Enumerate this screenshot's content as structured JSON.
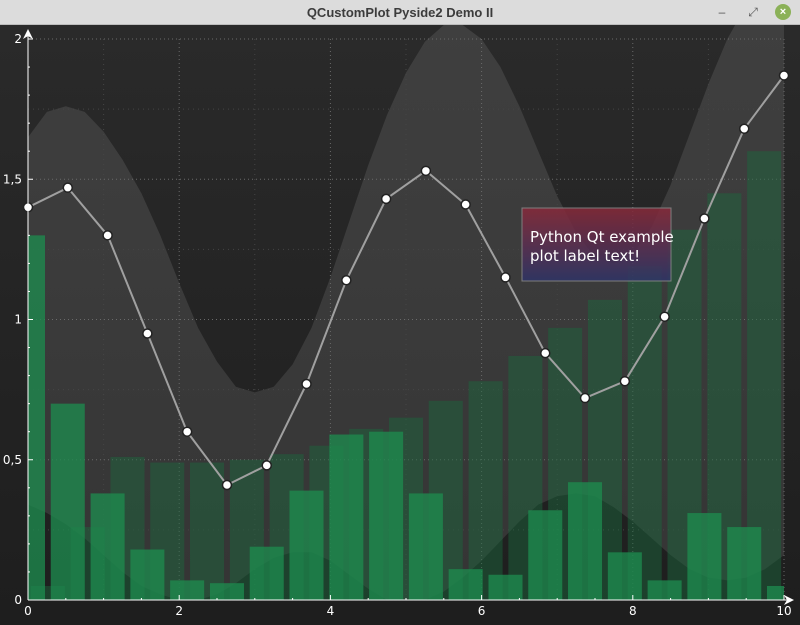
{
  "window": {
    "title": "QCustomPlot Pyside2 Demo II",
    "buttons": {
      "minimize": "–",
      "maximize": "⤢",
      "close": "×"
    }
  },
  "label_box": {
    "lines": [
      "Python Qt example",
      "plot label text!"
    ]
  },
  "colors": {
    "background_top": "#2a2a2a",
    "background_bottom": "#1e1e1e",
    "bar_front": "#1d8a4e",
    "bar_back": "#1a6a3f",
    "line": "#a0a0a0",
    "marker_fill": "#ffffff",
    "band": "#ffffff",
    "label_box_top": "#8a2a3a",
    "label_box_bottom": "#2e3468"
  },
  "chart_data": {
    "type": "line",
    "title": "",
    "xlabel": "",
    "ylabel": "",
    "xlim": [
      0,
      10
    ],
    "ylim": [
      0,
      2
    ],
    "x_ticks": [
      0,
      2,
      4,
      6,
      8,
      10
    ],
    "x_tick_labels": [
      "0",
      "2",
      "4",
      "6",
      "8",
      "10"
    ],
    "y_ticks": [
      0,
      0.5,
      1,
      1.5,
      2
    ],
    "y_tick_labels": [
      "0",
      "0,5",
      "1",
      "1,5",
      "2"
    ],
    "grid": true,
    "line_series": {
      "x": [
        0,
        0.526,
        1.053,
        1.579,
        2.105,
        2.632,
        3.158,
        3.684,
        4.211,
        4.737,
        5.263,
        5.789,
        6.316,
        6.842,
        7.368,
        7.895,
        8.421,
        8.947,
        9.474,
        10
      ],
      "y": [
        1.4,
        1.47,
        1.3,
        0.95,
        0.6,
        0.41,
        0.48,
        0.77,
        1.14,
        1.43,
        1.53,
        1.41,
        1.15,
        0.88,
        0.72,
        0.78,
        1.01,
        1.36,
        1.68,
        1.87
      ]
    },
    "bars_front": {
      "x": [
        0,
        0.526,
        1.053,
        1.579,
        2.105,
        2.632,
        3.158,
        3.684,
        4.211,
        4.737,
        5.263,
        5.789,
        6.316,
        6.842,
        7.368,
        7.895,
        8.421,
        8.947,
        9.474,
        10
      ],
      "values": [
        1.3,
        0.7,
        0.38,
        0.18,
        0.07,
        0.06,
        0.19,
        0.39,
        0.59,
        0.6,
        0.38,
        0.11,
        0.09,
        0.32,
        0.42,
        0.17,
        0.07,
        0.31,
        0.26,
        0.05
      ]
    },
    "bars_back": {
      "x": [
        0.263,
        0.789,
        1.316,
        1.842,
        2.368,
        2.895,
        3.421,
        3.947,
        4.474,
        5.0,
        5.526,
        6.053,
        6.579,
        7.105,
        7.632,
        8.158,
        8.684,
        9.211,
        9.737
      ],
      "values": [
        0.05,
        0.26,
        0.51,
        0.49,
        0.49,
        0.5,
        0.52,
        0.55,
        0.61,
        0.65,
        0.71,
        0.78,
        0.87,
        0.97,
        1.07,
        1.19,
        1.32,
        1.45,
        1.6
      ]
    },
    "band": {
      "x": [
        0,
        0.25,
        0.5,
        0.75,
        1,
        1.25,
        1.5,
        1.75,
        2,
        2.25,
        2.5,
        2.75,
        3,
        3.25,
        3.5,
        3.75,
        4,
        4.25,
        4.5,
        4.75,
        5,
        5.25,
        5.5,
        5.75,
        6,
        6.25,
        6.5,
        6.75,
        7,
        7.25,
        7.5,
        7.75,
        8,
        8.25,
        8.5,
        8.75,
        9,
        9.25,
        9.5,
        9.75,
        10
      ],
      "upper": [
        1.65,
        1.74,
        1.76,
        1.74,
        1.67,
        1.57,
        1.45,
        1.3,
        1.13,
        0.97,
        0.85,
        0.76,
        0.74,
        0.76,
        0.84,
        0.97,
        1.15,
        1.35,
        1.55,
        1.73,
        1.88,
        1.99,
        2.05,
        2.05,
        2.0,
        1.9,
        1.76,
        1.6,
        1.44,
        1.31,
        1.22,
        1.2,
        1.23,
        1.33,
        1.48,
        1.66,
        1.84,
        2.0,
        2.12,
        2.18,
        2.18
      ],
      "lower": [
        0.34,
        0.31,
        0.27,
        0.22,
        0.16,
        0.1,
        0.05,
        0.02,
        0.0,
        0.0,
        0.02,
        0.06,
        0.11,
        0.15,
        0.17,
        0.17,
        0.14,
        0.09,
        0.04,
        0.0,
        0.0,
        0.0,
        0.03,
        0.08,
        0.14,
        0.21,
        0.28,
        0.34,
        0.37,
        0.38,
        0.37,
        0.33,
        0.28,
        0.22,
        0.16,
        0.11,
        0.08,
        0.07,
        0.08,
        0.11,
        0.16
      ]
    }
  }
}
